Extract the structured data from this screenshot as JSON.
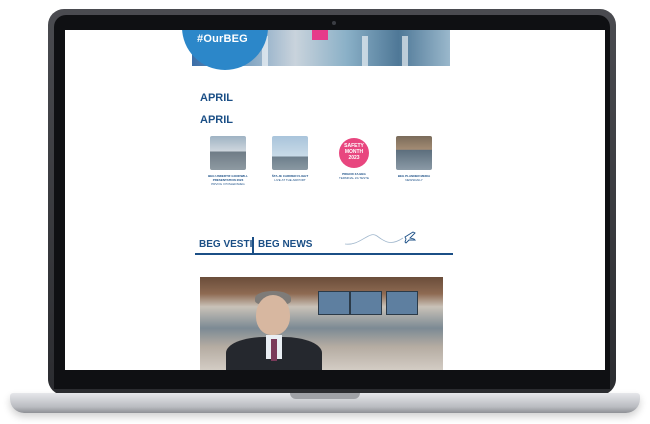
{
  "banner": {
    "hashtag": "#OurBEG"
  },
  "months": [
    "APRIL",
    "APRIL"
  ],
  "tiles": [
    {
      "icon": "airport-photo",
      "title": "BEG UNDERTIF GOODWILL PRESENTATION 2023",
      "subtitle": "PRVOG I POSLEDNJEG"
    },
    {
      "icon": "tower-photo",
      "title": "ŠTA JE CARRIER FLIGHT",
      "subtitle": "LIVE AT THE AIRPORT"
    },
    {
      "icon": "safety-badge",
      "badge_top": "SAFETY",
      "badge_mid": "MONTH",
      "badge_year": "2023",
      "title": "PRIHOD ZA BEG",
      "subtitle": "TERMINAL ZA TESTE"
    },
    {
      "icon": "meeting-photo",
      "title": "BEG PLANNER MEDIA",
      "subtitle": "NEWSDAILY"
    }
  ],
  "news_header": {
    "label_sr": "BEG VESTI",
    "label_en": "BEG NEWS"
  }
}
